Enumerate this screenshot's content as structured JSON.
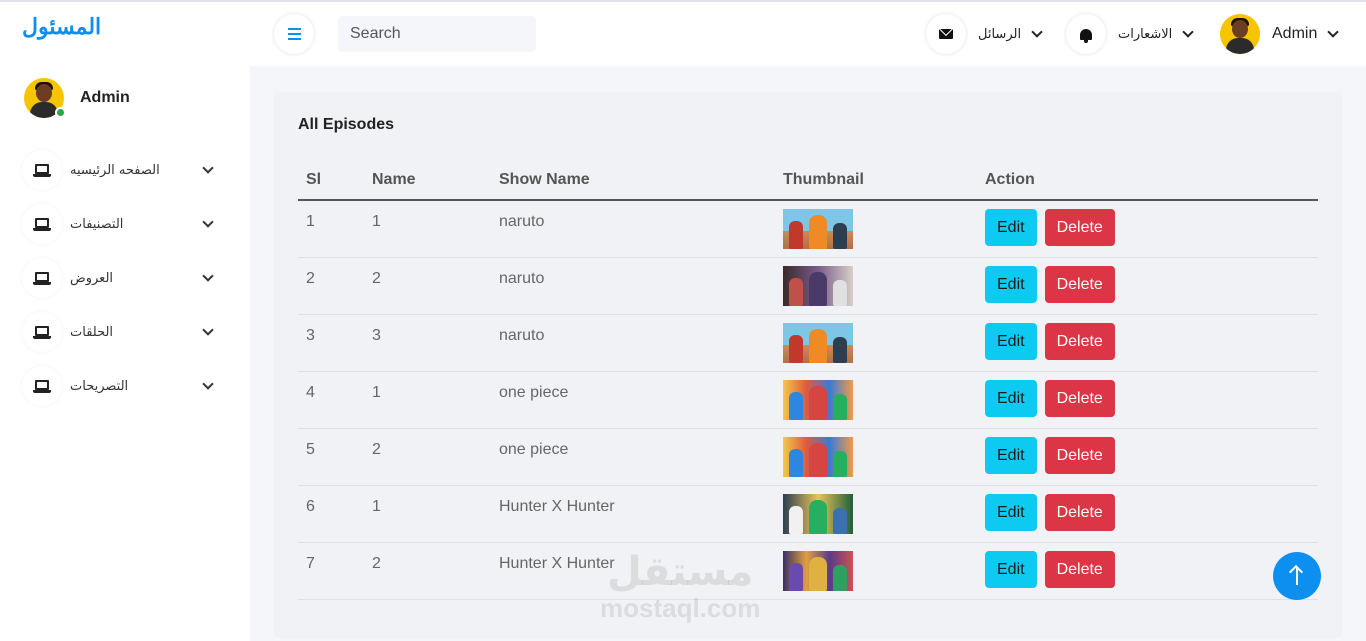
{
  "brand": "المسئول",
  "sidebar": {
    "user_name": "Admin",
    "items": [
      {
        "label": "الصفحه الرئيسيه"
      },
      {
        "label": "التصنيفات"
      },
      {
        "label": "العروض"
      },
      {
        "label": "الحلقات"
      },
      {
        "label": "التصريحات"
      }
    ]
  },
  "topbar": {
    "search_placeholder": "Search",
    "messages_label": "الرسائل",
    "notifications_label": "الاشعارات",
    "user_name": "Admin",
    "icons": {
      "menu": "hamburger-icon",
      "messages": "envelope-icon",
      "notifications": "bell-icon"
    }
  },
  "card": {
    "title": "All Episodes",
    "columns": [
      "Sl",
      "Name",
      "Show Name",
      "Thumbnail",
      "Action"
    ],
    "rows": [
      {
        "sl": "1",
        "name": "1",
        "show": "naruto",
        "thumb": "naruto"
      },
      {
        "sl": "2",
        "name": "2",
        "show": "naruto",
        "thumb": "naruto-dark"
      },
      {
        "sl": "3",
        "name": "3",
        "show": "naruto",
        "thumb": "naruto"
      },
      {
        "sl": "4",
        "name": "1",
        "show": "one piece",
        "thumb": "onepiece"
      },
      {
        "sl": "5",
        "name": "2",
        "show": "one piece",
        "thumb": "onepiece"
      },
      {
        "sl": "6",
        "name": "1",
        "show": "Hunter X Hunter",
        "thumb": "hxh"
      },
      {
        "sl": "7",
        "name": "2",
        "show": "Hunter X Hunter",
        "thumb": "hxh-group"
      }
    ],
    "edit_label": "Edit",
    "delete_label": "Delete"
  },
  "watermark": {
    "line1": "مستقل",
    "line2": "mostaql.com"
  },
  "colors": {
    "accent": "#0d8ff0",
    "edit": "#0dcaf0",
    "delete": "#dc3545",
    "online": "#28a745"
  }
}
